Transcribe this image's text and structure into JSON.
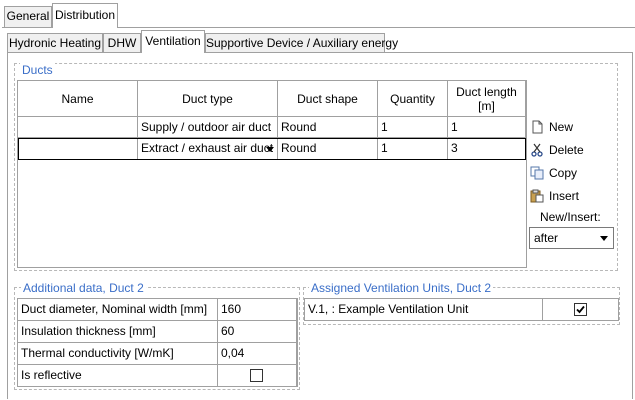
{
  "outer_tabs": [
    {
      "label": "General",
      "active": false
    },
    {
      "label": "Distribution",
      "active": true
    }
  ],
  "inner_tabs": [
    {
      "label": "Hydronic Heating",
      "active": false
    },
    {
      "label": "DHW",
      "active": false
    },
    {
      "label": "Ventilation",
      "active": true
    },
    {
      "label": "Supportive Device / Auxiliary energy",
      "active": false
    }
  ],
  "ducts": {
    "title": "Ducts",
    "columns": [
      "Name",
      "Duct type",
      "Duct shape",
      "Quantity",
      "Duct length\n[m]"
    ],
    "rows": [
      {
        "name": "",
        "duct_type": "Supply / outdoor air duct",
        "duct_shape": "Round",
        "quantity": "1",
        "length": "1"
      },
      {
        "name": "",
        "duct_type": "Extract / exhaust air duct",
        "duct_shape": "Round",
        "quantity": "1",
        "length": "3"
      }
    ],
    "actions": {
      "new": "New",
      "delete": "Delete",
      "copy": "Copy",
      "insert": "Insert",
      "new_insert_label": "New/Insert:",
      "new_insert_value": "after"
    }
  },
  "additional": {
    "title": "Additional data, Duct 2",
    "rows": [
      {
        "label": "Duct diameter, Nominal width  [mm]",
        "value": "160"
      },
      {
        "label": "Insulation thickness  [mm]",
        "value": "60"
      },
      {
        "label": "Thermal conductivity  [W/mK]",
        "value": "0,04"
      },
      {
        "label": "Is reflective",
        "value": ""
      }
    ]
  },
  "assigned": {
    "title": "Assigned Ventilation Units, Duct 2",
    "rows": [
      {
        "label": "V.1, : Example Ventilation Unit",
        "checked": true
      }
    ]
  },
  "colors": {
    "group_title": "#3a6ec8",
    "border": "#a0a0a0",
    "tab_bg": "#f0f0f0"
  }
}
